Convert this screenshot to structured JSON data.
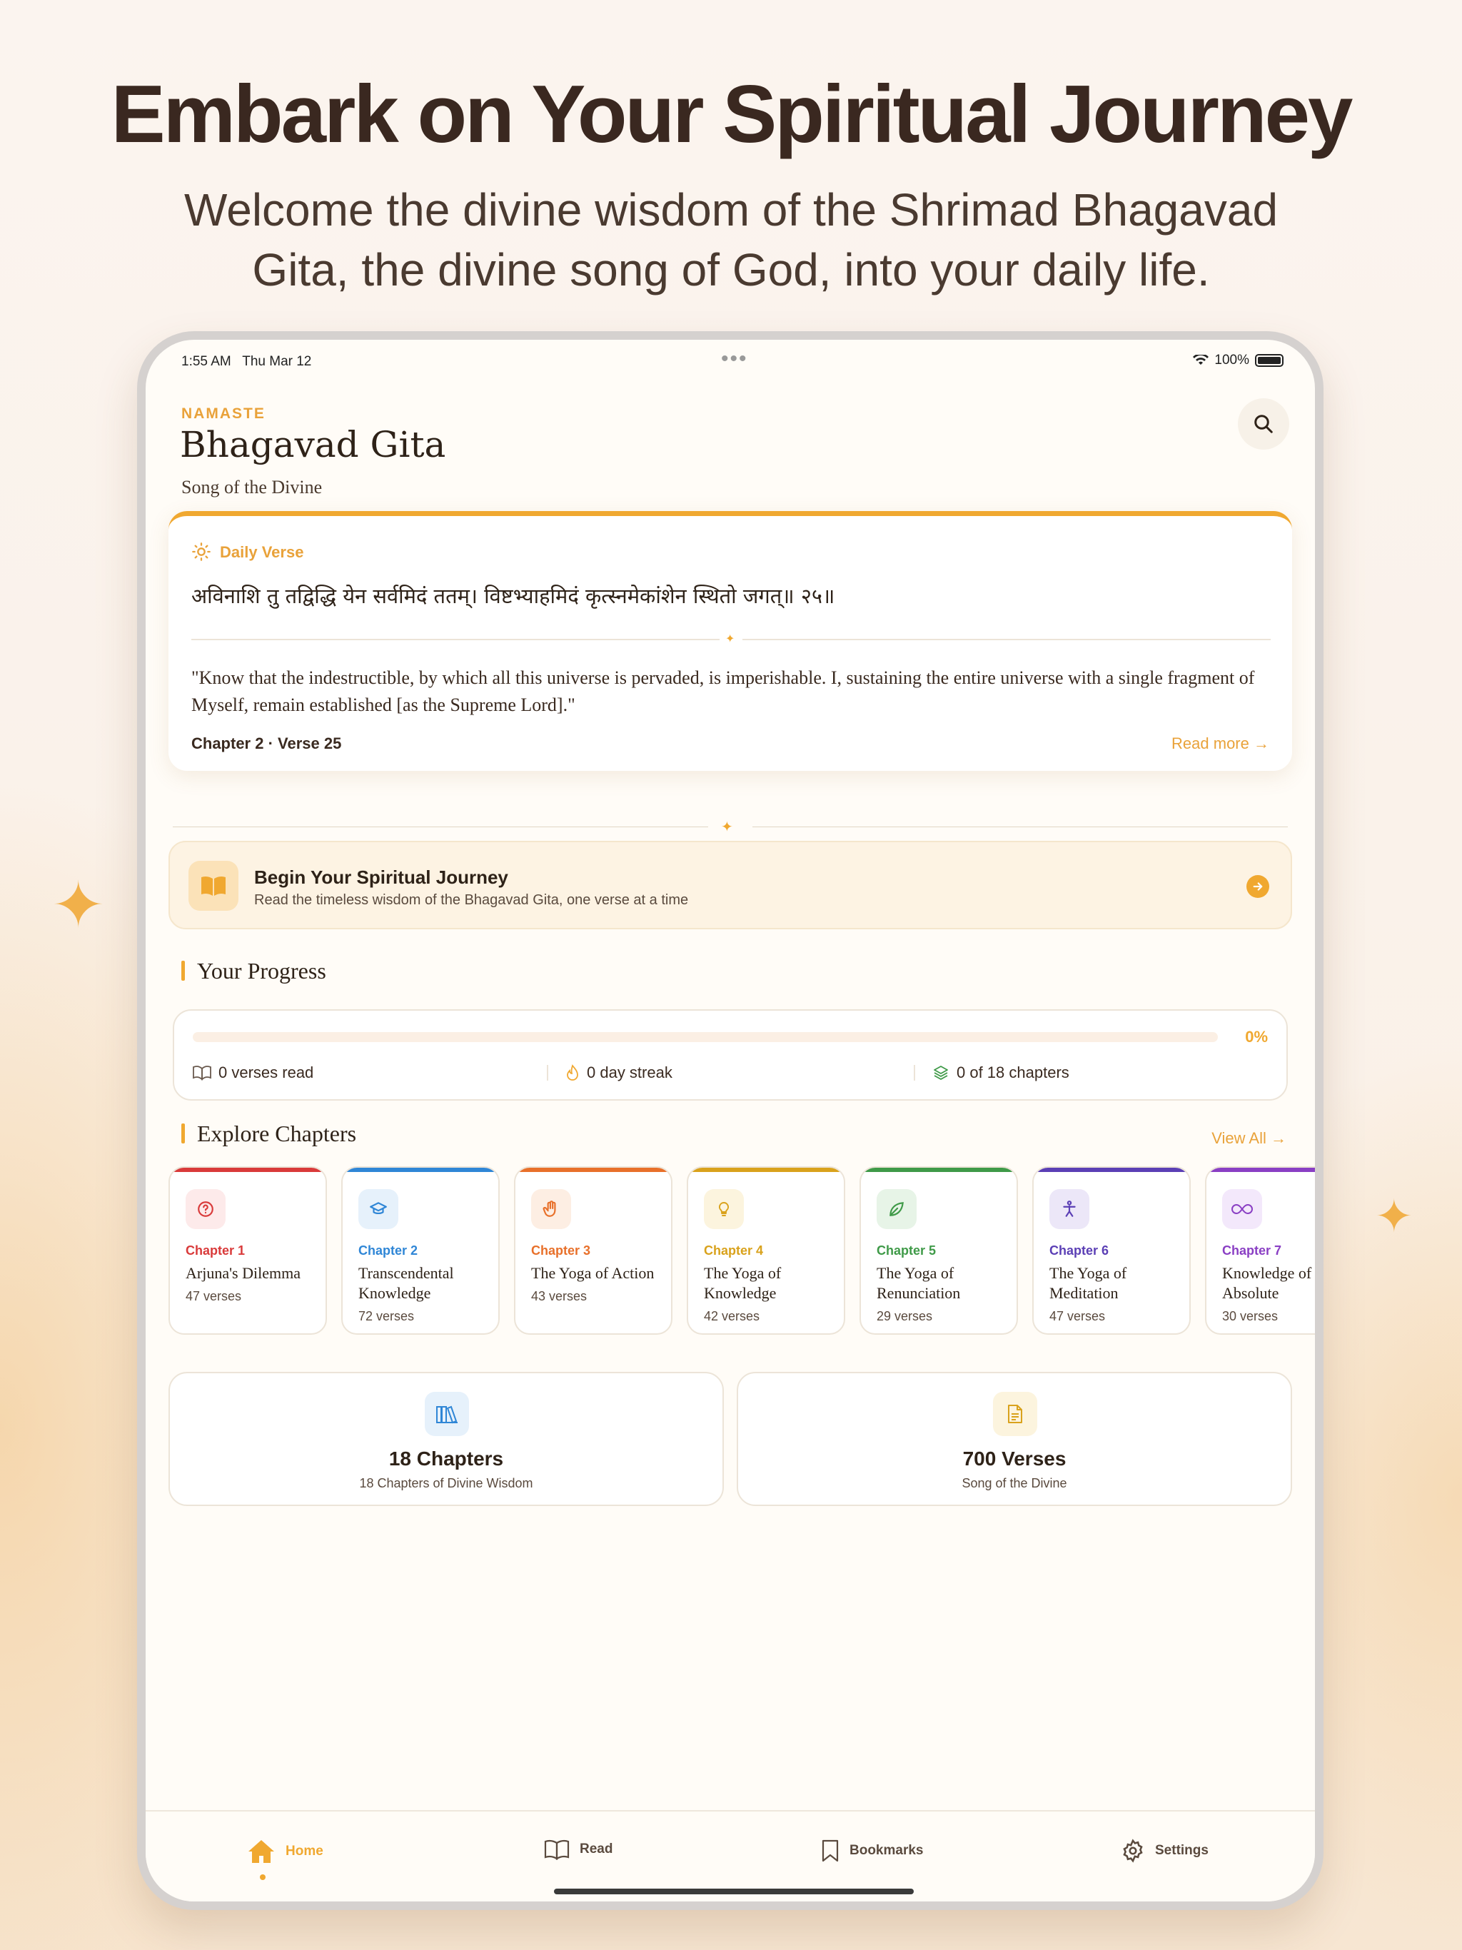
{
  "promo": {
    "headline": "Embark on Your Spiritual Journey",
    "subline": "Welcome the divine wisdom of the Shrimad Bhagavad Gita, the divine song of God, into your daily life."
  },
  "status": {
    "time": "1:55 AM",
    "date": "Thu Mar 12",
    "battery": "100%"
  },
  "header": {
    "greeting": "NAMASTE",
    "title": "Bhagavad Gita",
    "subtitle": "Song of the Divine",
    "search_icon": "search-icon"
  },
  "daily_verse": {
    "label": "Daily Verse",
    "sanskrit": "अविनाशि तु तद्विद्धि येन सर्वमिदं ततम्। विष्टभ्याहमिदं कृत्स्नमेकांशेन स्थितो जगत्॥ २५॥",
    "translation": "\"Know that the indestructible, by which all this universe is pervaded, is imperishable. I, sustaining the entire universe with a single fragment of Myself, remain established [as the Supreme Lord].\"",
    "reference": "Chapter 2 · Verse 25",
    "read_more": "Read more"
  },
  "journey": {
    "title": "Begin Your Spiritual Journey",
    "description": "Read the timeless wisdom of the Bhagavad Gita, one verse at a time"
  },
  "progress": {
    "title": "Your Progress",
    "percent": "0%",
    "fraction": 0,
    "verses_read": "0 verses read",
    "streak": "0 day streak",
    "chapters": "0 of 18 chapters"
  },
  "explore": {
    "title": "Explore Chapters",
    "view_all": "View All"
  },
  "chapters": [
    {
      "num": "Chapter 1",
      "name": "Arjuna's Dilemma",
      "verses": "47 verses",
      "color": "#d93a3a",
      "tint": "#fdeaea",
      "icon": "question-circle-icon"
    },
    {
      "num": "Chapter 2",
      "name": "Transcendental Knowledge",
      "verses": "72 verses",
      "color": "#2f86d6",
      "tint": "#e6f1fb",
      "icon": "graduation-cap-icon"
    },
    {
      "num": "Chapter 3",
      "name": "The Yoga of Action",
      "verses": "43 verses",
      "color": "#e8702a",
      "tint": "#fdeee3",
      "icon": "hand-icon"
    },
    {
      "num": "Chapter 4",
      "name": "The Yoga of Knowledge",
      "verses": "42 verses",
      "color": "#d9a21c",
      "tint": "#fcf4de",
      "icon": "lightbulb-icon"
    },
    {
      "num": "Chapter 5",
      "name": "The Yoga of Renunciation",
      "verses": "29 verses",
      "color": "#3f9a48",
      "tint": "#e7f4e7",
      "icon": "leaf-icon"
    },
    {
      "num": "Chapter 6",
      "name": "The Yoga of Meditation",
      "verses": "47 verses",
      "color": "#5b3fb5",
      "tint": "#ece7f8",
      "icon": "meditation-figure-icon"
    },
    {
      "num": "Chapter 7",
      "name": "Knowledge of the Absolute",
      "verses": "30 verses",
      "color": "#8a3fc4",
      "tint": "#f3e8fb",
      "icon": "infinity-icon"
    }
  ],
  "summary": [
    {
      "title": "18 Chapters",
      "desc": "18 Chapters of Divine Wisdom",
      "icon": "library-icon"
    },
    {
      "title": "700 Verses",
      "desc": "Song of the Divine",
      "icon": "document-icon"
    }
  ],
  "tabs": {
    "home": "Home",
    "read": "Read",
    "bookmarks": "Bookmarks",
    "settings": "Settings"
  },
  "colors": {
    "accent": "#f0a830",
    "background": "#fffcf7"
  }
}
